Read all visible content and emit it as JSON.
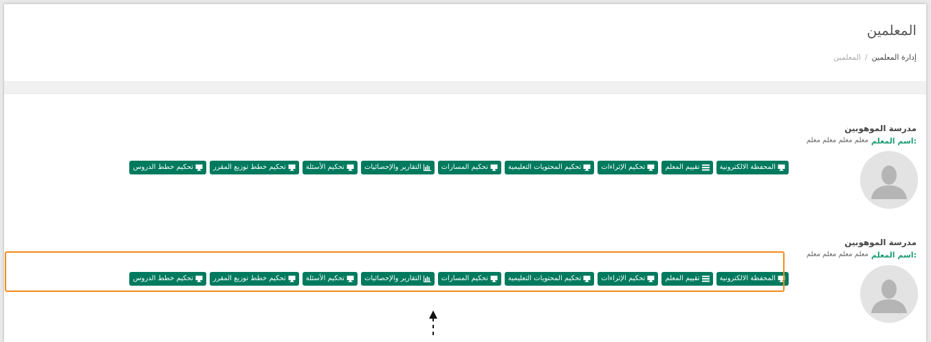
{
  "page": {
    "title": "المعلمين",
    "breadcrumb": {
      "link": "إدارة المعلمين",
      "separator": "/",
      "current": "المعلمين"
    }
  },
  "teachers": [
    {
      "school": "مدرسة الموهوبين",
      "name_label": "اسم المعلم:",
      "name_value": "معلم معلم معلم معلم",
      "actions": [
        {
          "label": "المحفظة الالكترونية",
          "icon": "monitor-icon"
        },
        {
          "label": "تقييم المعلم",
          "icon": "list-icon"
        },
        {
          "label": "تحكيم الإثراءات",
          "icon": "monitor-icon"
        },
        {
          "label": "تحكيم المحتويات التعليمية",
          "icon": "monitor-icon"
        },
        {
          "label": "تحكيم المسارات",
          "icon": "monitor-icon"
        },
        {
          "label": "التقارير والإحصائيات",
          "icon": "bar-chart-icon"
        },
        {
          "label": "تحكيم الأسئلة",
          "icon": "monitor-icon"
        },
        {
          "label": "تحكيم خطط توزيع المقرر",
          "icon": "monitor-icon"
        },
        {
          "label": "تحكيم خطط الدروس",
          "icon": "monitor-icon"
        }
      ]
    },
    {
      "school": "مدرسة الموهوبين",
      "name_label": "اسم المعلم:",
      "name_value": "معلم معلم معلم معلم",
      "actions": [
        {
          "label": "المحفظة الالكترونية",
          "icon": "monitor-icon"
        },
        {
          "label": "تقييم المعلم",
          "icon": "list-icon"
        },
        {
          "label": "تحكيم الإثراءات",
          "icon": "monitor-icon"
        },
        {
          "label": "تحكيم المحتويات التعليمية",
          "icon": "monitor-icon"
        },
        {
          "label": "تحكيم المسارات",
          "icon": "monitor-icon"
        },
        {
          "label": "التقارير والإحصائيات",
          "icon": "bar-chart-icon"
        },
        {
          "label": "تحكيم الأسئلة",
          "icon": "monitor-icon"
        },
        {
          "label": "تحكيم خطط توزيع المقرر",
          "icon": "monitor-icon"
        },
        {
          "label": "تحكيم خطط الدروس",
          "icon": "monitor-icon"
        }
      ]
    }
  ],
  "colors": {
    "button_green": "#007a5e",
    "label_green": "#1a9c6e",
    "highlight_orange": "#f28a16",
    "arrow": "#111111"
  }
}
